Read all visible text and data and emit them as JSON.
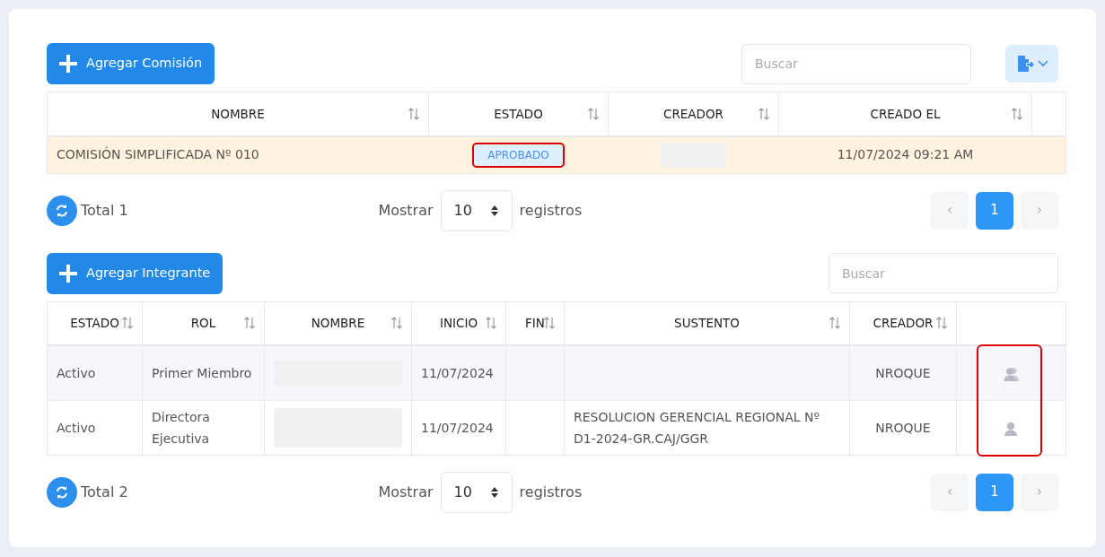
{
  "commissions": {
    "add_button": "Agregar Comisión",
    "search": {
      "placeholder": "Buscar"
    },
    "columns": [
      {
        "label": "NOMBRE"
      },
      {
        "label": "ESTADO"
      },
      {
        "label": "CREADOR"
      },
      {
        "label": "CREADO EL"
      }
    ],
    "rows": [
      {
        "selected": true,
        "nombre": "COMISIÓN SIMPLIFICADA Nº 010",
        "estado": "APROBADO",
        "estado_highlighted": true,
        "creador_redacted": true,
        "creado_el": "11/07/2024 09:21 AM"
      }
    ],
    "footer": {
      "total": "Total 1",
      "show_label": "Mostrar",
      "page_size": "10",
      "records_label": "registros",
      "prev": "‹",
      "next": "›",
      "pages": [
        {
          "label": "1",
          "selected": true
        }
      ]
    }
  },
  "members": {
    "add_button": "Agregar Integrante",
    "search": {
      "placeholder": "Buscar"
    },
    "columns": [
      {
        "label": "ESTADO"
      },
      {
        "label": "ROL"
      },
      {
        "label": "NOMBRE"
      },
      {
        "label": "INICIO"
      },
      {
        "label": "FIN"
      },
      {
        "label": "SUSTENTO"
      },
      {
        "label": "CREADOR"
      }
    ],
    "actions_highlighted": true,
    "rows": [
      {
        "estado": "Activo",
        "rol": "Primer Miembro",
        "nombre_redacted": true,
        "inicio": "11/07/2024",
        "sustento": "",
        "creador": "NROQUE",
        "kind": "users"
      },
      {
        "estado": "Activo",
        "rol": "Directora Ejecutiva",
        "nombre_redacted": true,
        "inicio": "11/07/2024",
        "sustento": "RESOLUCION GERENCIAL REGIONAL Nº D1-2024-GR.CAJ/GGR",
        "creador": "NROQUE",
        "kind": "user"
      }
    ],
    "footer": {
      "total": "Total 2",
      "show_label": "Mostrar",
      "page_size": "10",
      "records_label": "registros",
      "prev": "‹",
      "next": "›",
      "pages": [
        {
          "label": "1",
          "selected": true
        }
      ]
    }
  }
}
